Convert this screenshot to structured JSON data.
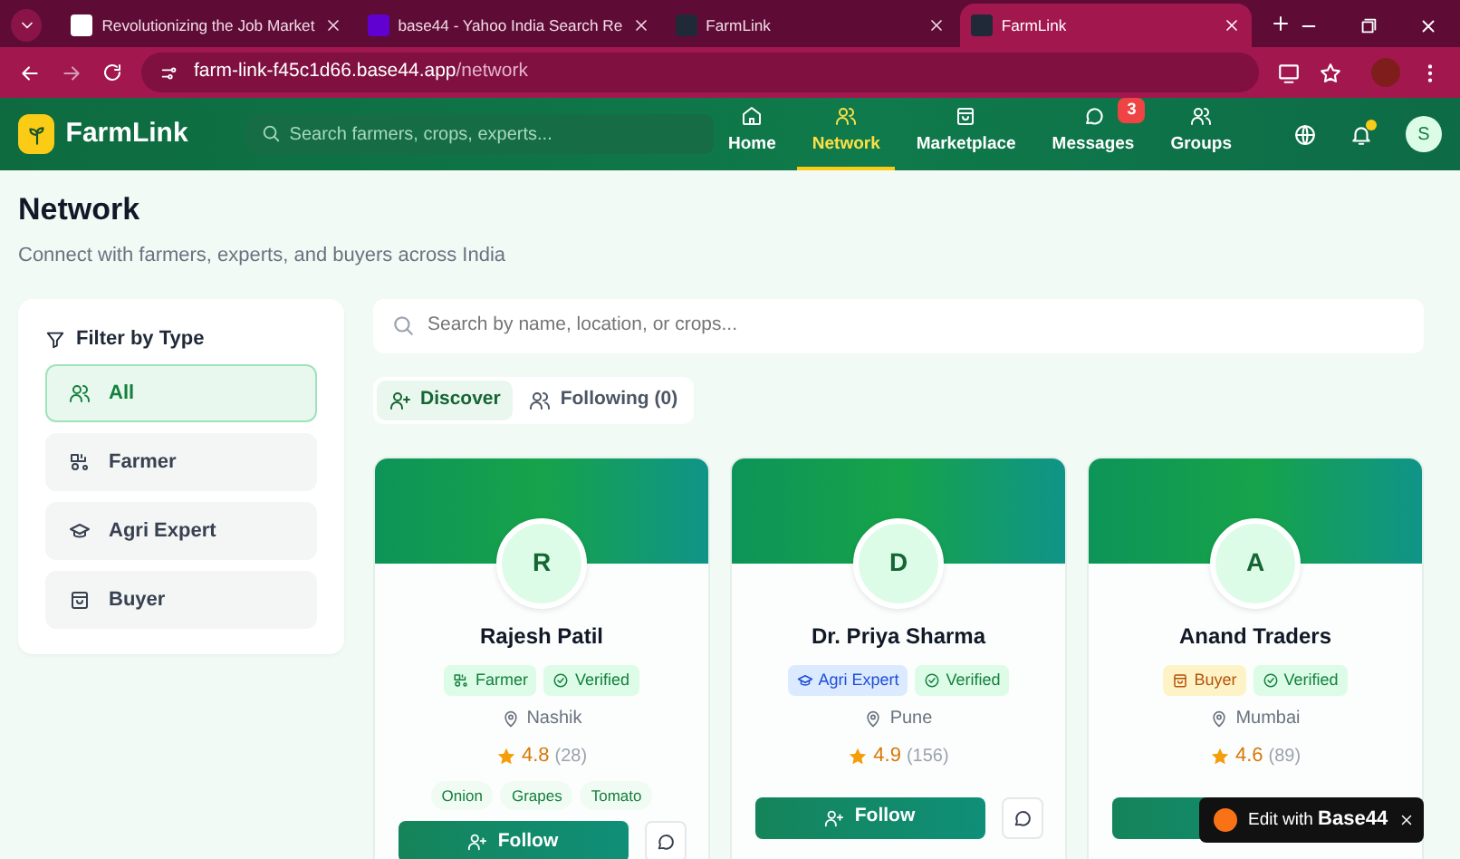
{
  "browser": {
    "tabs": [
      {
        "title": "Revolutionizing the Job Market",
        "selected": false
      },
      {
        "title": "base44 - Yahoo India Search Re",
        "selected": false
      },
      {
        "title": "FarmLink",
        "selected": false
      },
      {
        "title": "FarmLink",
        "selected": true
      }
    ],
    "url": {
      "host": "farm-link-f45c1d66.base44.app",
      "path": "/network"
    }
  },
  "header": {
    "brand": "FarmLink",
    "search_placeholder": "Search farmers, crops, experts...",
    "nav": [
      {
        "label": "Home",
        "selected": false
      },
      {
        "label": "Network",
        "selected": true
      },
      {
        "label": "Marketplace",
        "selected": false
      },
      {
        "label": "Messages",
        "selected": false,
        "badge": "3"
      },
      {
        "label": "Groups",
        "selected": false
      }
    ],
    "notification_dot": true,
    "user_initial": "S"
  },
  "page": {
    "title": "Network",
    "subtitle": "Connect with farmers, experts, and buyers across India"
  },
  "filter": {
    "title": "Filter by Type",
    "items": [
      {
        "label": "All",
        "selected": true
      },
      {
        "label": "Farmer",
        "selected": false
      },
      {
        "label": "Agri Expert",
        "selected": false
      },
      {
        "label": "Buyer",
        "selected": false
      }
    ]
  },
  "search_placeholder": "Search by name, location, or crops...",
  "view_tabs": [
    {
      "label": "Discover",
      "selected": true
    },
    {
      "label": "Following (0)",
      "selected": false
    }
  ],
  "profiles": [
    {
      "initial": "R",
      "name": "Rajesh Patil",
      "role": {
        "kind": "farmer",
        "label": "Farmer"
      },
      "verified": "Verified",
      "location": "Nashik",
      "rating": "4.8",
      "reviews": "(28)",
      "crops": [
        "Onion",
        "Grapes",
        "Tomato"
      ],
      "follow": "Follow"
    },
    {
      "initial": "D",
      "name": "Dr. Priya Sharma",
      "role": {
        "kind": "expert",
        "label": "Agri Expert"
      },
      "verified": "Verified",
      "location": "Pune",
      "rating": "4.9",
      "reviews": "(156)",
      "follow": "Follow"
    },
    {
      "initial": "A",
      "name": "Anand Traders",
      "role": {
        "kind": "buyer",
        "label": "Buyer"
      },
      "verified": "Verified",
      "location": "Mumbai",
      "rating": "4.6",
      "reviews": "(89)"
    }
  ],
  "overlay": {
    "label": "Edit with",
    "brand": "Base44"
  }
}
